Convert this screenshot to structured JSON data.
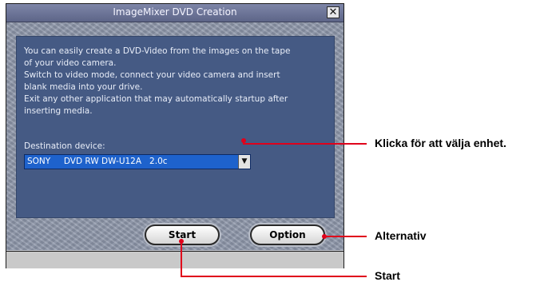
{
  "window": {
    "title": "ImageMixer DVD Creation",
    "close_symbol": "✕",
    "description": "You can easily create a DVD-Video from the images on the tape\nof your video camera.\nSwitch to video mode,  connect your video camera and insert\nblank media into your drive.\nExit any other application that may automatically startup after\ninserting media.",
    "destination_label": "Destination device:",
    "destination_value": "SONY     DVD RW DW-U12A   2.0c",
    "dropdown_arrow": "▼",
    "buttons": {
      "start": "Start",
      "option": "Option"
    }
  },
  "callouts": {
    "device": "Klicka för att välja enhet.",
    "option": "Alternativ",
    "start": "Start"
  },
  "colors": {
    "callout_line": "#e0001b",
    "panel": "#455a84",
    "selection": "#1e62cc"
  },
  "icons": [
    "close-icon",
    "dropdown-arrow-icon"
  ]
}
